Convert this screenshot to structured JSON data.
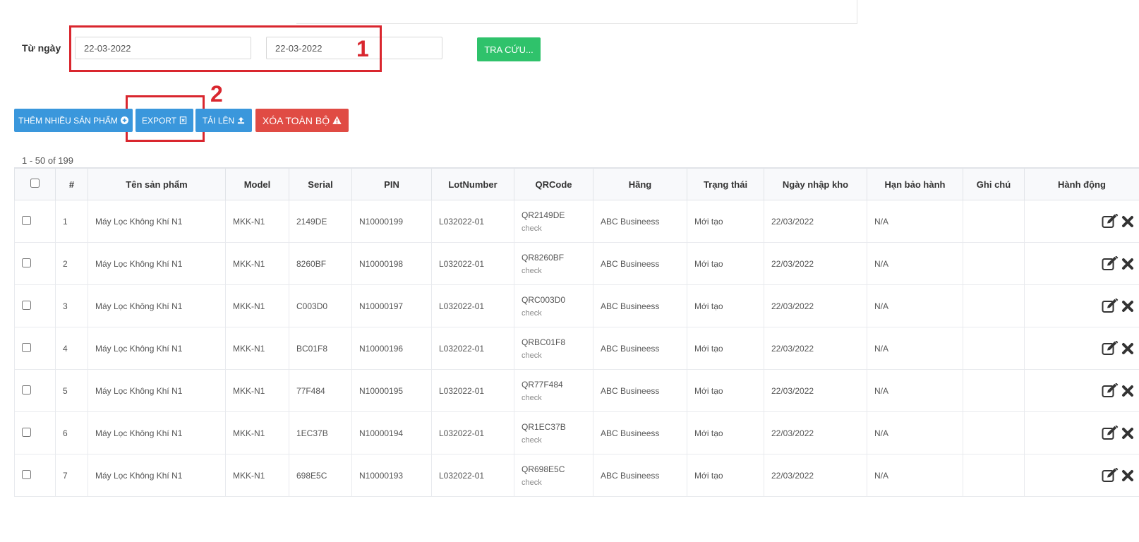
{
  "filter": {
    "from_label": "Từ ngày",
    "date_from": "22-03-2022",
    "date_to": "22-03-2022",
    "search_label": "TRA CỨU..."
  },
  "annotations": {
    "one": "1",
    "two": "2"
  },
  "toolbar": {
    "add_label": "THÊM NHIỀU SẢN PHẨM",
    "export_label": "EXPORT",
    "upload_label": "TẢI LÊN",
    "delete_label": "XÓA TOÀN BỘ"
  },
  "pagination": {
    "text": "1 - 50 of 199"
  },
  "table": {
    "columns": [
      "#",
      "Tên sản phẩm",
      "Model",
      "Serial",
      "PIN",
      "LotNumber",
      "QRCode",
      "Hãng",
      "Trạng thái",
      "Ngày nhập kho",
      "Hạn bảo hành",
      "Ghi chú",
      "Hành động"
    ],
    "rows": [
      {
        "no": "1",
        "name": "Máy Lọc Không Khí N1",
        "model": "MKK-N1",
        "serial": "2149DE",
        "pin": "N10000199",
        "lot": "L032022-01",
        "qr": "QR2149DE",
        "qr_sub": "check",
        "brand": "ABC Busineess",
        "status": "Mới tạo",
        "date": "22/03/2022",
        "warranty": "N/A",
        "note": ""
      },
      {
        "no": "2",
        "name": "Máy Lọc Không Khí N1",
        "model": "MKK-N1",
        "serial": "8260BF",
        "pin": "N10000198",
        "lot": "L032022-01",
        "qr": "QR8260BF",
        "qr_sub": "check",
        "brand": "ABC Busineess",
        "status": "Mới tạo",
        "date": "22/03/2022",
        "warranty": "N/A",
        "note": ""
      },
      {
        "no": "3",
        "name": "Máy Lọc Không Khí N1",
        "model": "MKK-N1",
        "serial": "C003D0",
        "pin": "N10000197",
        "lot": "L032022-01",
        "qr": "QRC003D0",
        "qr_sub": "check",
        "brand": "ABC Busineess",
        "status": "Mới tạo",
        "date": "22/03/2022",
        "warranty": "N/A",
        "note": ""
      },
      {
        "no": "4",
        "name": "Máy Lọc Không Khí N1",
        "model": "MKK-N1",
        "serial": "BC01F8",
        "pin": "N10000196",
        "lot": "L032022-01",
        "qr": "QRBC01F8",
        "qr_sub": "check",
        "brand": "ABC Busineess",
        "status": "Mới tạo",
        "date": "22/03/2022",
        "warranty": "N/A",
        "note": ""
      },
      {
        "no": "5",
        "name": "Máy Lọc Không Khí N1",
        "model": "MKK-N1",
        "serial": "77F484",
        "pin": "N10000195",
        "lot": "L032022-01",
        "qr": "QR77F484",
        "qr_sub": "check",
        "brand": "ABC Busineess",
        "status": "Mới tạo",
        "date": "22/03/2022",
        "warranty": "N/A",
        "note": ""
      },
      {
        "no": "6",
        "name": "Máy Lọc Không Khí N1",
        "model": "MKK-N1",
        "serial": "1EC37B",
        "pin": "N10000194",
        "lot": "L032022-01",
        "qr": "QR1EC37B",
        "qr_sub": "check",
        "brand": "ABC Busineess",
        "status": "Mới tạo",
        "date": "22/03/2022",
        "warranty": "N/A",
        "note": ""
      },
      {
        "no": "7",
        "name": "Máy Lọc Không Khí N1",
        "model": "MKK-N1",
        "serial": "698E5C",
        "pin": "N10000193",
        "lot": "L032022-01",
        "qr": "QR698E5C",
        "qr_sub": "check",
        "brand": "ABC Busineess",
        "status": "Mới tạo",
        "date": "22/03/2022",
        "warranty": "N/A",
        "note": ""
      }
    ]
  },
  "icons": {
    "add": "plus-circle-icon",
    "export": "file-excel-icon",
    "upload": "upload-icon",
    "delete": "warning-icon",
    "edit": "edit-icon",
    "remove": "close-icon"
  },
  "colors": {
    "primary": "#3a97dc",
    "success": "#2fc26b",
    "danger": "#e04b44",
    "annotation": "#d9262e"
  }
}
